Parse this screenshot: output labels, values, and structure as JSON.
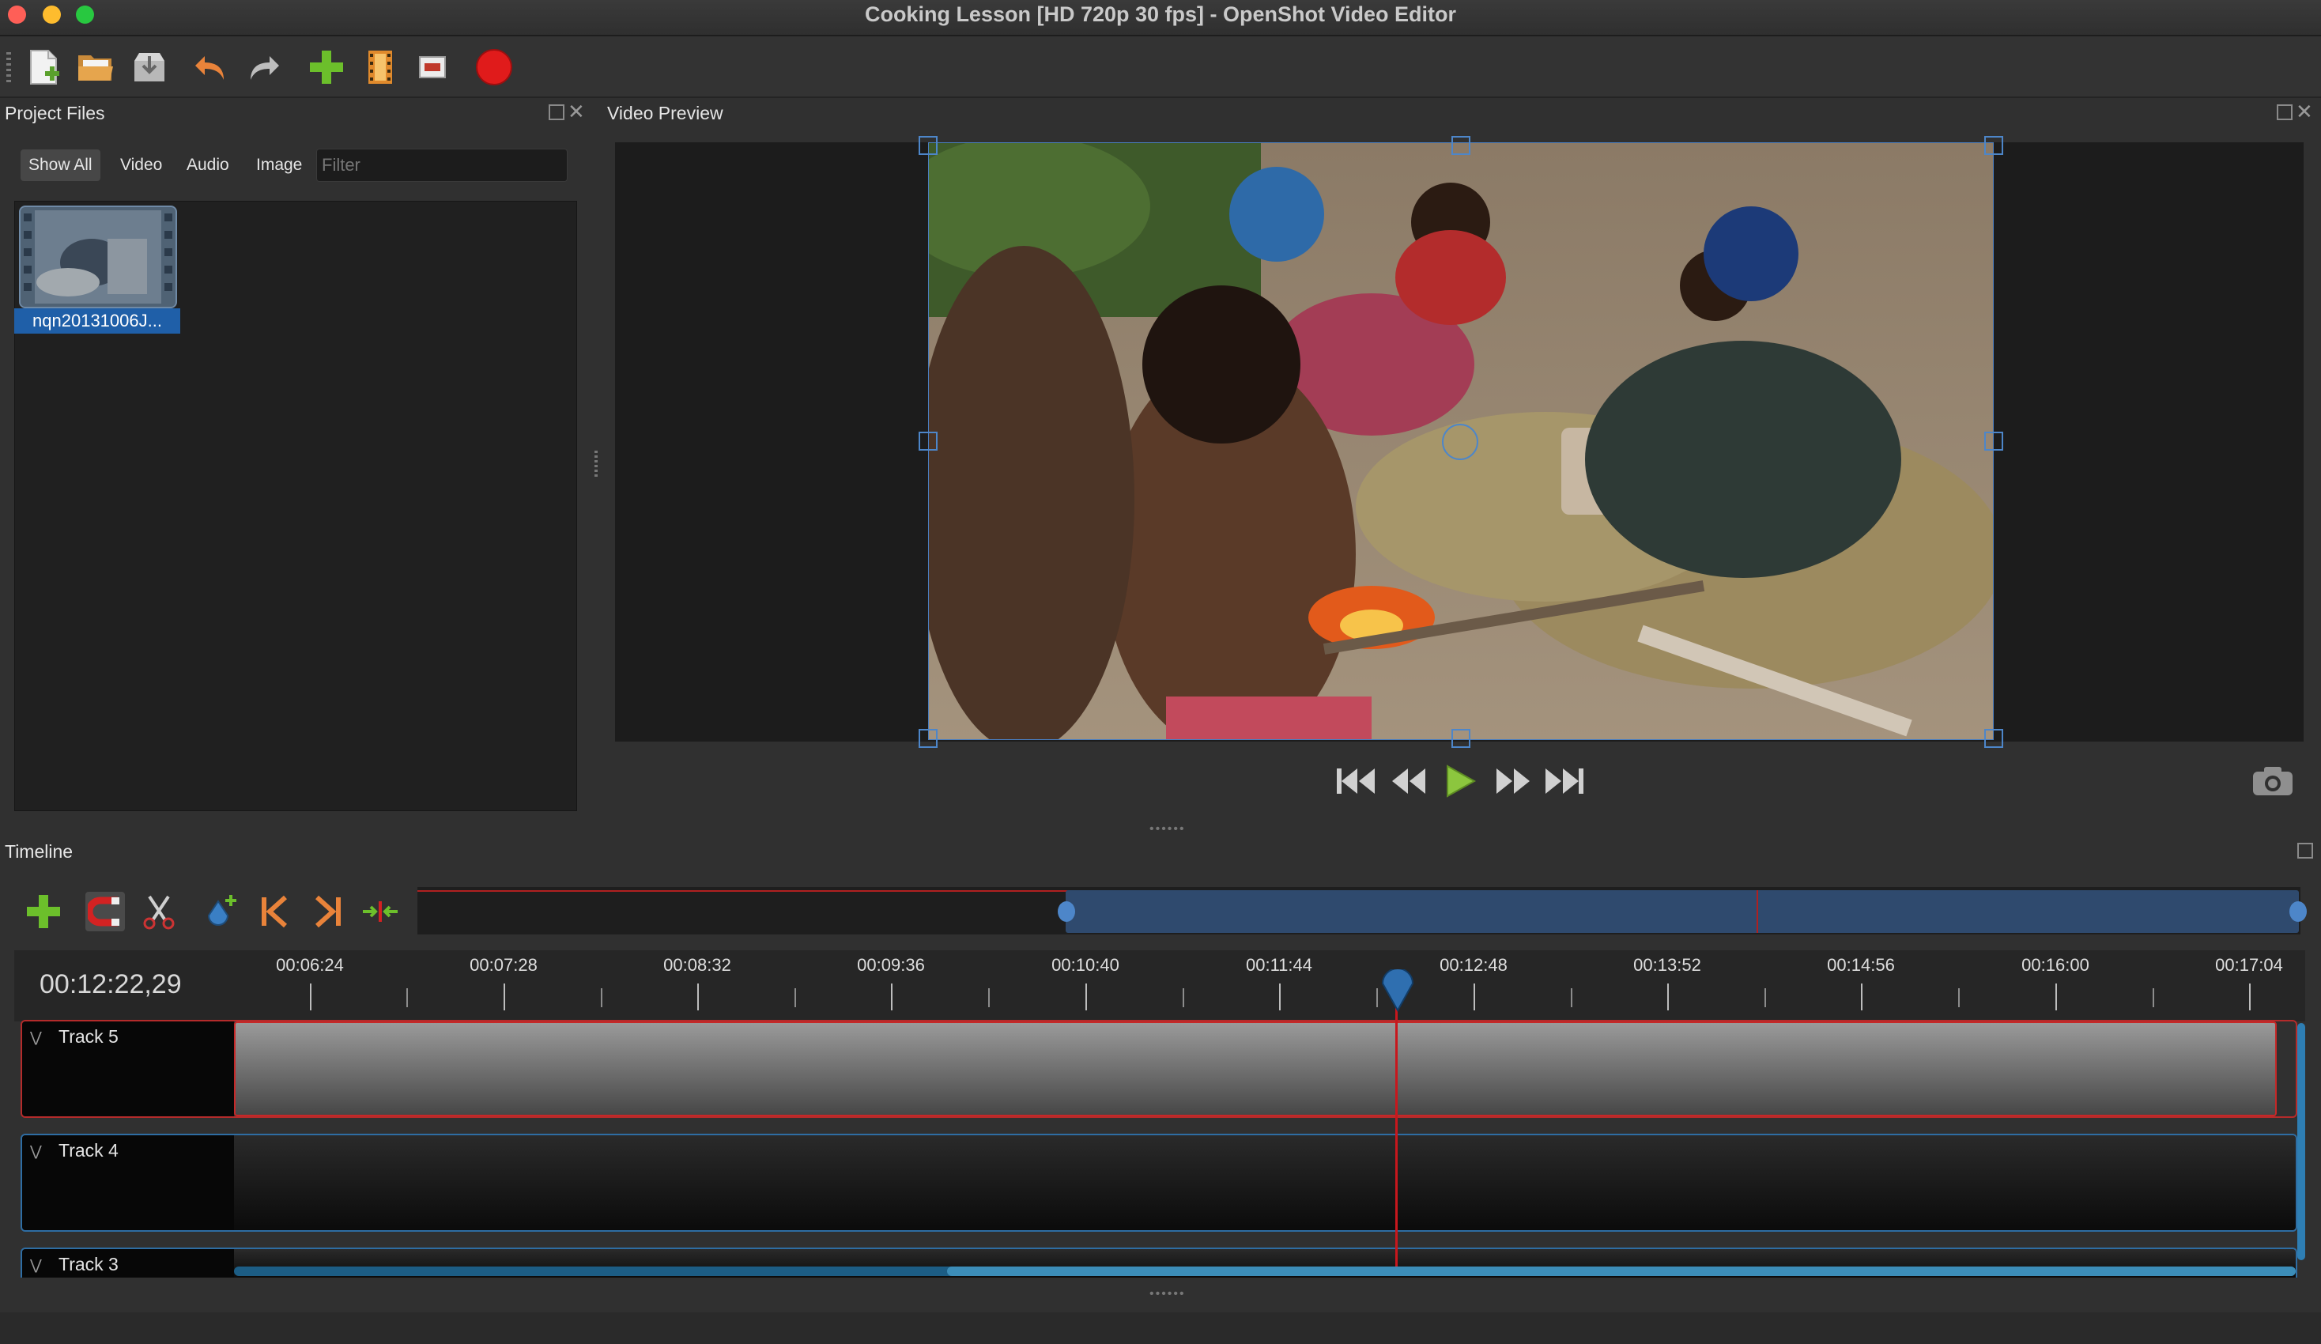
{
  "window": {
    "title": "Cooking Lesson [HD 720p 30 fps] - OpenShot Video Editor",
    "traffic_colors": [
      "#fe5f57",
      "#febc2e",
      "#28c840"
    ]
  },
  "toolbar": {
    "items": [
      {
        "name": "new-project",
        "icon": "new-file-icon"
      },
      {
        "name": "open-project",
        "icon": "folder-open-icon"
      },
      {
        "name": "save-project",
        "icon": "save-icon"
      },
      {
        "name": "undo",
        "icon": "undo-icon"
      },
      {
        "name": "redo",
        "icon": "redo-icon"
      },
      {
        "name": "import-files",
        "icon": "plus-icon"
      },
      {
        "name": "choose-profile",
        "icon": "film-strip-icon"
      },
      {
        "name": "fullscreen",
        "icon": "fullscreen-icon"
      },
      {
        "name": "export-video",
        "icon": "record-icon"
      }
    ]
  },
  "project_files": {
    "title": "Project Files",
    "tabs": [
      "Show All",
      "Video",
      "Audio",
      "Image"
    ],
    "active_tab": "Show All",
    "filter_placeholder": "Filter",
    "files": [
      {
        "label": "nqn20131006J..."
      }
    ]
  },
  "video_preview": {
    "title": "Video Preview",
    "controls": [
      "jump-start-icon",
      "rewind-icon",
      "play-icon",
      "fast-forward-icon",
      "jump-end-icon"
    ],
    "snapshot_icon": "camera-icon"
  },
  "timeline": {
    "title": "Timeline",
    "current_time": "00:12:22,29",
    "tools": [
      "add-track-icon",
      "snap-magnet-icon",
      "razor-icon",
      "add-marker-icon",
      "prev-marker-icon",
      "next-marker-icon",
      "center-playhead-icon"
    ],
    "ruler_labels": [
      "00:06:24",
      "00:07:28",
      "00:08:32",
      "00:09:36",
      "00:10:40",
      "00:11:44",
      "00:12:48",
      "00:13:52",
      "00:14:56",
      "00:16:00",
      "00:17:04"
    ],
    "tracks": [
      {
        "name": "Track 5"
      },
      {
        "name": "Track 4"
      },
      {
        "name": "Track 3"
      }
    ]
  },
  "colors": {
    "accent_blue": "#2e6da3",
    "playhead_red": "#c8171d",
    "selection_blue": "#1f5fa8"
  }
}
